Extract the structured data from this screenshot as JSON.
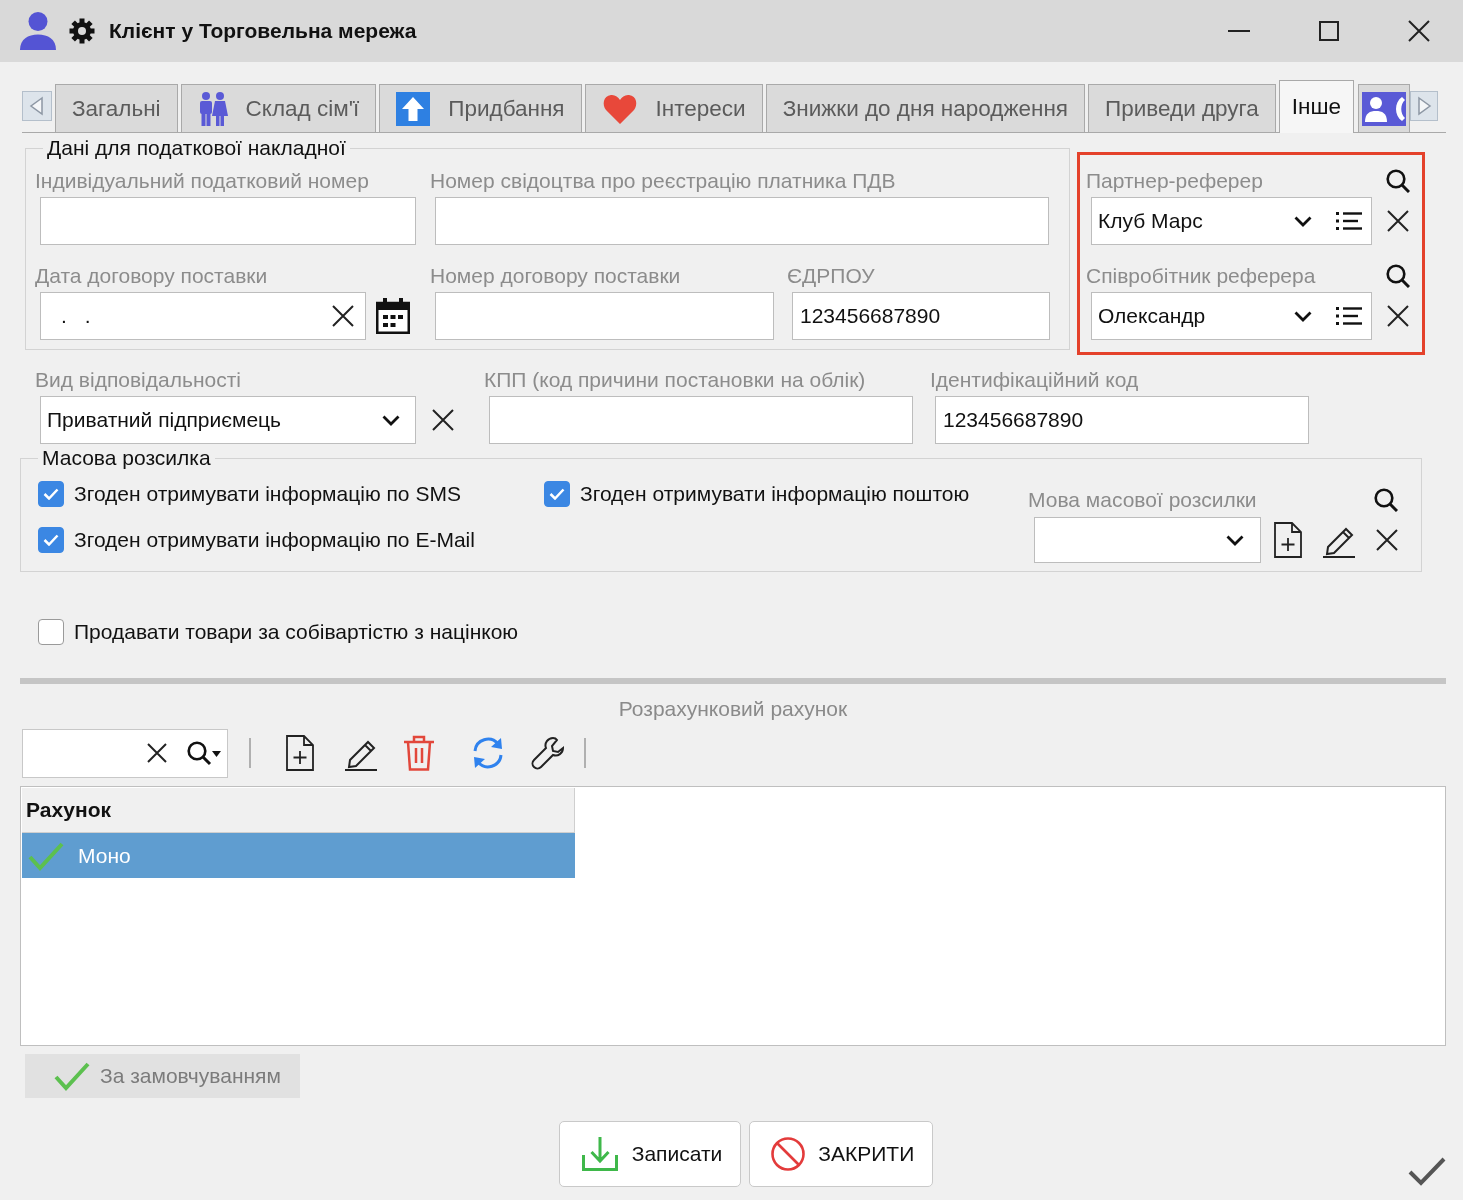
{
  "window": {
    "title": "Клієнт у Торговельна мережа"
  },
  "tabs": [
    {
      "label": "Загальні",
      "kind": "plain",
      "selected": false
    },
    {
      "label": "Склад сім'ї",
      "kind": "family",
      "selected": false
    },
    {
      "label": "Придбання",
      "kind": "upload",
      "selected": false
    },
    {
      "label": "Інтереси",
      "kind": "heart",
      "selected": false
    },
    {
      "label": "Знижки до дня народження",
      "kind": "plain",
      "selected": false
    },
    {
      "label": "Приведи друга",
      "kind": "plain",
      "selected": false
    },
    {
      "label": "Інше",
      "kind": "plain",
      "selected": true
    },
    {
      "kind": "contact",
      "selected": false
    }
  ],
  "tax_data": {
    "title": "Дані для податкової накладної",
    "rows": [
      [
        {
          "kind": "text",
          "label": "Індивідуальний податковий номер"
        },
        {
          "kind": "text",
          "label": "Номер свідоцтва про реєстрацію платника ПДВ"
        }
      ],
      [
        {
          "kind": "date",
          "label": "Дата договору поставки",
          "value": ". ."
        },
        {
          "kind": "text",
          "label": "Номер договору поставки"
        },
        {
          "kind": "text",
          "label": "ЄДРПОУ",
          "value": "123456687890"
        }
      ]
    ]
  },
  "referrer": {
    "highlighted": true,
    "fields": [
      {
        "label": "Партнер-реферер",
        "value": "Клуб Марс"
      },
      {
        "label": "Співробітник реферера",
        "value": "Олександр"
      }
    ]
  },
  "details": [
    {
      "kind": "combo",
      "label": "Вид відповідальності",
      "value": "Приватний підприємець"
    },
    {
      "kind": "text",
      "label": "КПП (код причини постановки на облік)"
    },
    {
      "kind": "text",
      "label": "Ідентифікаційний код",
      "value": "123456687890"
    }
  ],
  "mailing": {
    "title": "Масова розсилка",
    "options": [
      {
        "label": "Згоден отримувати інформацію по SMS",
        "checked": true
      },
      {
        "label": "Згоден отримувати інформацію по E-Mail",
        "checked": true
      },
      {
        "label": "Згоден отримувати інформацію поштою",
        "checked": true
      }
    ],
    "language": {
      "label": "Мова масової розсилки"
    }
  },
  "cost_markup": {
    "label": "Продавати товари за собівартістю з націнкою",
    "checked": false
  },
  "accounts": {
    "title": "Розрахунковий рахунок",
    "table": {
      "columns": [
        "Рахунок"
      ],
      "rows": [
        {
          "cells": [
            "Моно"
          ],
          "selected": true,
          "default": true
        }
      ]
    },
    "default_button": {
      "label": "За замовчуванням",
      "disabled": true
    }
  },
  "buttons": [
    {
      "kind": "save",
      "label": "Записати"
    },
    {
      "kind": "close",
      "label": "ЗАКРИТИ"
    }
  ]
}
